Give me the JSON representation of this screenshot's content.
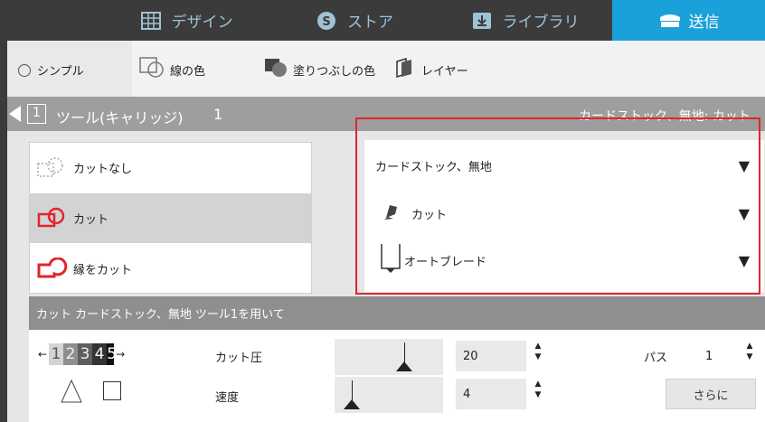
{
  "nav": {
    "tabs": [
      {
        "label": "デザイン",
        "icon": "grid-icon"
      },
      {
        "label": "ストア",
        "icon": "store-s-icon"
      },
      {
        "label": "ライブラリ",
        "icon": "library-download-icon"
      },
      {
        "label": "送信",
        "icon": "send-cutter-icon"
      }
    ],
    "active": "送信",
    "accent": "#1ba1d9"
  },
  "subbar": {
    "simple": "シンプル",
    "line_color": "線の色",
    "fill_color": "塗りつぶしの色",
    "layer": "レイヤー"
  },
  "tool_header": {
    "tool_number": "1",
    "label": "ツール(キャリッジ)",
    "index": "1",
    "material_truncated": "カードストック、無地: カット"
  },
  "modes": [
    {
      "label": "カットなし",
      "icon": "no-cut-icon",
      "selected": false
    },
    {
      "label": "カット",
      "icon": "cut-icon",
      "selected": true
    },
    {
      "label": "縁をカット",
      "icon": "cut-edge-icon",
      "selected": false
    }
  ],
  "material": {
    "material": "カードストック、無地",
    "action": "カット",
    "tool": "オートブレード"
  },
  "status": {
    "prefix": "カット",
    "material": "カードストック、無地",
    "suffix": "ツール1を用いて"
  },
  "settings": {
    "tool_digits": [
      "1",
      "2",
      "3",
      "4",
      "5"
    ],
    "force_label": "カット圧",
    "force_value": "20",
    "speed_label": "速度",
    "speed_value": "4",
    "passes_label": "パス",
    "passes_value": "1",
    "more_button": "さらに"
  },
  "colors": {
    "highlight_red": "#e0262c",
    "cut_icon_red": "#e0262c"
  }
}
